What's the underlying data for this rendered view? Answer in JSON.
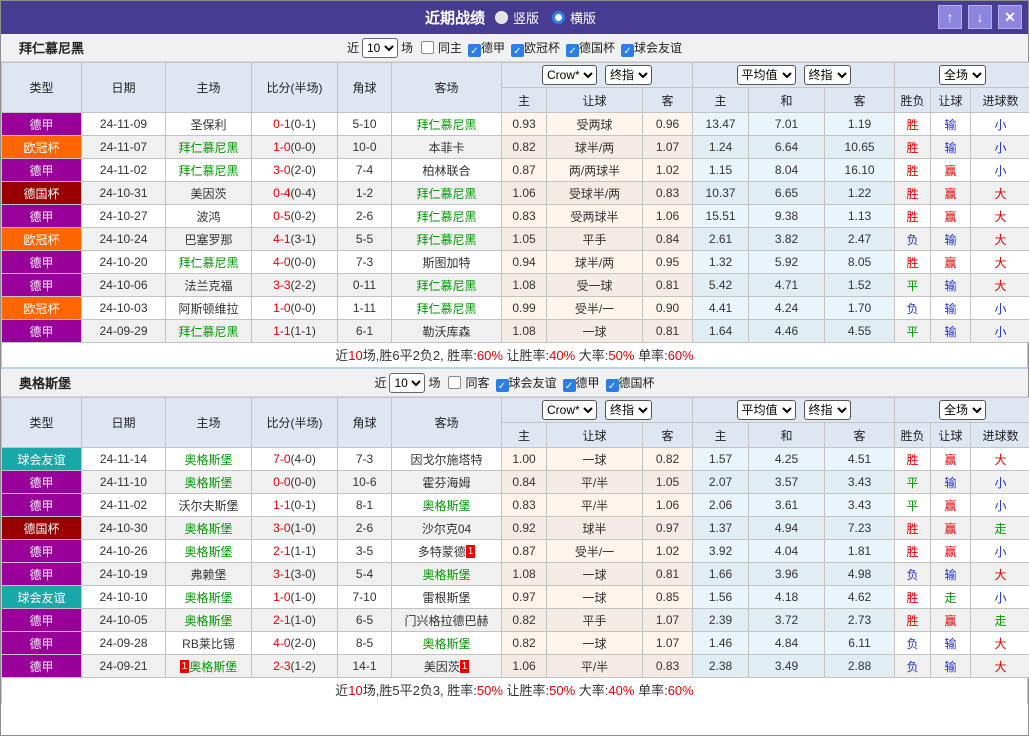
{
  "titlebar": {
    "title": "近期战绩",
    "vertical_label": "竖版",
    "horizontal_label": "横版",
    "up_icon": "↑",
    "down_icon": "↓",
    "close_icon": "✕"
  },
  "labels": {
    "near": "近",
    "matches": "场"
  },
  "table_header": {
    "type": "类型",
    "date": "日期",
    "home": "主场",
    "score": "比分(半场)",
    "corner": "角球",
    "away": "客场",
    "crow_select": "Crow*",
    "final_select": "终指",
    "avg_select": "平均值",
    "full_select": "全场",
    "sub": [
      "主",
      "让球",
      "客",
      "主",
      "和",
      "客",
      "胜负",
      "让球",
      "进球数"
    ]
  },
  "league_colors": {
    "德甲": "#990099",
    "欧冠杯": "#ff6600",
    "德国杯": "#990000",
    "球会友谊": "#18a8a8"
  },
  "result_colors": {
    "胜": "#e60000",
    "平": "#009900",
    "负": "#2233cc",
    "赢": "#e60000",
    "输": "#2233cc",
    "走": "#009900",
    "大": "#e60000",
    "小": "#2233cc"
  },
  "sections": [
    {
      "team": "拜仁慕尼黑",
      "count": "10",
      "same_label": "同主",
      "leagues": [
        "德甲",
        "欧冠杯",
        "德国杯",
        "球会友谊"
      ],
      "rows": [
        {
          "league": "德甲",
          "date": "24-11-09",
          "home": "圣保利",
          "home_focus": false,
          "score": "0-1",
          "half": "(0-1)",
          "corner": "5-10",
          "away": "拜仁慕尼黑",
          "away_focus": true,
          "odds": [
            "0.93",
            "受两球",
            "0.96"
          ],
          "avg": [
            "13.47",
            "7.01",
            "1.19"
          ],
          "res": [
            "胜",
            "输",
            "小"
          ]
        },
        {
          "league": "欧冠杯",
          "date": "24-11-07",
          "home": "拜仁慕尼黑",
          "home_focus": true,
          "score": "1-0",
          "half": "(0-0)",
          "corner": "10-0",
          "away": "本菲卡",
          "away_focus": false,
          "odds": [
            "0.82",
            "球半/两",
            "1.07"
          ],
          "avg": [
            "1.24",
            "6.64",
            "10.65"
          ],
          "res": [
            "胜",
            "输",
            "小"
          ]
        },
        {
          "league": "德甲",
          "date": "24-11-02",
          "home": "拜仁慕尼黑",
          "home_focus": true,
          "score": "3-0",
          "half": "(2-0)",
          "corner": "7-4",
          "away": "柏林联合",
          "away_focus": false,
          "odds": [
            "0.87",
            "两/两球半",
            "1.02"
          ],
          "avg": [
            "1.15",
            "8.04",
            "16.10"
          ],
          "res": [
            "胜",
            "赢",
            "小"
          ]
        },
        {
          "league": "德国杯",
          "date": "24-10-31",
          "home": "美因茨",
          "home_focus": false,
          "score": "0-4",
          "half": "(0-4)",
          "corner": "1-2",
          "away": "拜仁慕尼黑",
          "away_focus": true,
          "odds": [
            "1.06",
            "受球半/两",
            "0.83"
          ],
          "avg": [
            "10.37",
            "6.65",
            "1.22"
          ],
          "res": [
            "胜",
            "赢",
            "大"
          ]
        },
        {
          "league": "德甲",
          "date": "24-10-27",
          "home": "波鸿",
          "home_focus": false,
          "score": "0-5",
          "half": "(0-2)",
          "corner": "2-6",
          "away": "拜仁慕尼黑",
          "away_focus": true,
          "odds": [
            "0.83",
            "受两球半",
            "1.06"
          ],
          "avg": [
            "15.51",
            "9.38",
            "1.13"
          ],
          "res": [
            "胜",
            "赢",
            "大"
          ]
        },
        {
          "league": "欧冠杯",
          "date": "24-10-24",
          "home": "巴塞罗那",
          "home_focus": false,
          "score": "4-1",
          "half": "(3-1)",
          "corner": "5-5",
          "away": "拜仁慕尼黑",
          "away_focus": true,
          "odds": [
            "1.05",
            "平手",
            "0.84"
          ],
          "avg": [
            "2.61",
            "3.82",
            "2.47"
          ],
          "res": [
            "负",
            "输",
            "大"
          ]
        },
        {
          "league": "德甲",
          "date": "24-10-20",
          "home": "拜仁慕尼黑",
          "home_focus": true,
          "score": "4-0",
          "half": "(0-0)",
          "corner": "7-3",
          "away": "斯图加特",
          "away_focus": false,
          "odds": [
            "0.94",
            "球半/两",
            "0.95"
          ],
          "avg": [
            "1.32",
            "5.92",
            "8.05"
          ],
          "res": [
            "胜",
            "赢",
            "大"
          ]
        },
        {
          "league": "德甲",
          "date": "24-10-06",
          "home": "法兰克福",
          "home_focus": false,
          "score": "3-3",
          "half": "(2-2)",
          "corner": "0-11",
          "away": "拜仁慕尼黑",
          "away_focus": true,
          "odds": [
            "1.08",
            "受一球",
            "0.81"
          ],
          "avg": [
            "5.42",
            "4.71",
            "1.52"
          ],
          "res": [
            "平",
            "输",
            "大"
          ]
        },
        {
          "league": "欧冠杯",
          "date": "24-10-03",
          "home": "阿斯顿维拉",
          "home_focus": false,
          "score": "1-0",
          "half": "(0-0)",
          "corner": "1-11",
          "away": "拜仁慕尼黑",
          "away_focus": true,
          "odds": [
            "0.99",
            "受半/一",
            "0.90"
          ],
          "avg": [
            "4.41",
            "4.24",
            "1.70"
          ],
          "res": [
            "负",
            "输",
            "小"
          ]
        },
        {
          "league": "德甲",
          "date": "24-09-29",
          "home": "拜仁慕尼黑",
          "home_focus": true,
          "score": "1-1",
          "half": "(1-1)",
          "corner": "6-1",
          "away": "勒沃库森",
          "away_focus": false,
          "odds": [
            "1.08",
            "一球",
            "0.81"
          ],
          "avg": [
            "1.64",
            "4.46",
            "4.55"
          ],
          "res": [
            "平",
            "输",
            "小"
          ]
        }
      ],
      "summary": [
        {
          "text": "近",
          "red": false
        },
        {
          "text": "10",
          "red": true
        },
        {
          "text": "场,胜6平2负2, 胜率:",
          "red": false
        },
        {
          "text": "60%",
          "red": true
        },
        {
          "text": " 让胜率:",
          "red": false
        },
        {
          "text": "40%",
          "red": true
        },
        {
          "text": " 大率:",
          "red": false
        },
        {
          "text": "50%",
          "red": true
        },
        {
          "text": " 单率:",
          "red": false
        },
        {
          "text": "60%",
          "red": true
        }
      ]
    },
    {
      "team": "奥格斯堡",
      "count": "10",
      "same_label": "同客",
      "leagues": [
        "球会友谊",
        "德甲",
        "德国杯"
      ],
      "rows": [
        {
          "league": "球会友谊",
          "date": "24-11-14",
          "home": "奥格斯堡",
          "home_focus": true,
          "score": "7-0",
          "half": "(4-0)",
          "corner": "7-3",
          "away": "因戈尔施塔特",
          "away_focus": false,
          "odds": [
            "1.00",
            "一球",
            "0.82"
          ],
          "avg": [
            "1.57",
            "4.25",
            "4.51"
          ],
          "res": [
            "胜",
            "赢",
            "大"
          ]
        },
        {
          "league": "德甲",
          "date": "24-11-10",
          "home": "奥格斯堡",
          "home_focus": true,
          "score": "0-0",
          "half": "(0-0)",
          "corner": "10-6",
          "away": "霍芬海姆",
          "away_focus": false,
          "odds": [
            "0.84",
            "平/半",
            "1.05"
          ],
          "avg": [
            "2.07",
            "3.57",
            "3.43"
          ],
          "res": [
            "平",
            "输",
            "小"
          ]
        },
        {
          "league": "德甲",
          "date": "24-11-02",
          "home": "沃尔夫斯堡",
          "home_focus": false,
          "score": "1-1",
          "half": "(0-1)",
          "corner": "8-1",
          "away": "奥格斯堡",
          "away_focus": true,
          "odds": [
            "0.83",
            "平/半",
            "1.06"
          ],
          "avg": [
            "2.06",
            "3.61",
            "3.43"
          ],
          "res": [
            "平",
            "赢",
            "小"
          ]
        },
        {
          "league": "德国杯",
          "date": "24-10-30",
          "home": "奥格斯堡",
          "home_focus": true,
          "score": "3-0",
          "half": "(1-0)",
          "corner": "2-6",
          "away": "沙尔克04",
          "away_focus": false,
          "odds": [
            "0.92",
            "球半",
            "0.97"
          ],
          "avg": [
            "1.37",
            "4.94",
            "7.23"
          ],
          "res": [
            "胜",
            "赢",
            "走"
          ]
        },
        {
          "league": "德甲",
          "date": "24-10-26",
          "home": "奥格斯堡",
          "home_focus": true,
          "score": "2-1",
          "half": "(1-1)",
          "corner": "3-5",
          "away": "多特蒙德",
          "away_focus": false,
          "away_badge_post": "1",
          "odds": [
            "0.87",
            "受半/一",
            "1.02"
          ],
          "avg": [
            "3.92",
            "4.04",
            "1.81"
          ],
          "res": [
            "胜",
            "赢",
            "小"
          ]
        },
        {
          "league": "德甲",
          "date": "24-10-19",
          "home": "弗赖堡",
          "home_focus": false,
          "score": "3-1",
          "half": "(3-0)",
          "corner": "5-4",
          "away": "奥格斯堡",
          "away_focus": true,
          "odds": [
            "1.08",
            "一球",
            "0.81"
          ],
          "avg": [
            "1.66",
            "3.96",
            "4.98"
          ],
          "res": [
            "负",
            "输",
            "大"
          ]
        },
        {
          "league": "球会友谊",
          "date": "24-10-10",
          "home": "奥格斯堡",
          "home_focus": true,
          "score": "1-0",
          "half": "(1-0)",
          "corner": "7-10",
          "away": "雷根斯堡",
          "away_focus": false,
          "odds": [
            "0.97",
            "一球",
            "0.85"
          ],
          "avg": [
            "1.56",
            "4.18",
            "4.62"
          ],
          "res": [
            "胜",
            "走",
            "小"
          ]
        },
        {
          "league": "德甲",
          "date": "24-10-05",
          "home": "奥格斯堡",
          "home_focus": true,
          "score": "2-1",
          "half": "(1-0)",
          "corner": "6-5",
          "away": "门兴格拉德巴赫",
          "away_focus": false,
          "odds": [
            "0.82",
            "平手",
            "1.07"
          ],
          "avg": [
            "2.39",
            "3.72",
            "2.73"
          ],
          "res": [
            "胜",
            "赢",
            "走"
          ]
        },
        {
          "league": "德甲",
          "date": "24-09-28",
          "home": "RB莱比锡",
          "home_focus": false,
          "score": "4-0",
          "half": "(2-0)",
          "corner": "8-5",
          "away": "奥格斯堡",
          "away_focus": true,
          "odds": [
            "0.82",
            "一球",
            "1.07"
          ],
          "avg": [
            "1.46",
            "4.84",
            "6.11"
          ],
          "res": [
            "负",
            "输",
            "大"
          ]
        },
        {
          "league": "德甲",
          "date": "24-09-21",
          "home": "奥格斯堡",
          "home_focus": true,
          "home_badge_pre": "1",
          "score": "2-3",
          "half": "(1-2)",
          "corner": "14-1",
          "away": "美因茨",
          "away_focus": false,
          "away_badge_post": "1",
          "odds": [
            "1.06",
            "平/半",
            "0.83"
          ],
          "avg": [
            "2.38",
            "3.49",
            "2.88"
          ],
          "res": [
            "负",
            "输",
            "大"
          ]
        }
      ],
      "summary": [
        {
          "text": "近",
          "red": false
        },
        {
          "text": "10",
          "red": true
        },
        {
          "text": "场,胜5平2负3, 胜率:",
          "red": false
        },
        {
          "text": "50%",
          "red": true
        },
        {
          "text": " 让胜率:",
          "red": false
        },
        {
          "text": "50%",
          "red": true
        },
        {
          "text": " 大率:",
          "red": false
        },
        {
          "text": "40%",
          "red": true
        },
        {
          "text": " 单率:",
          "red": false
        },
        {
          "text": "60%",
          "red": true
        }
      ]
    }
  ]
}
